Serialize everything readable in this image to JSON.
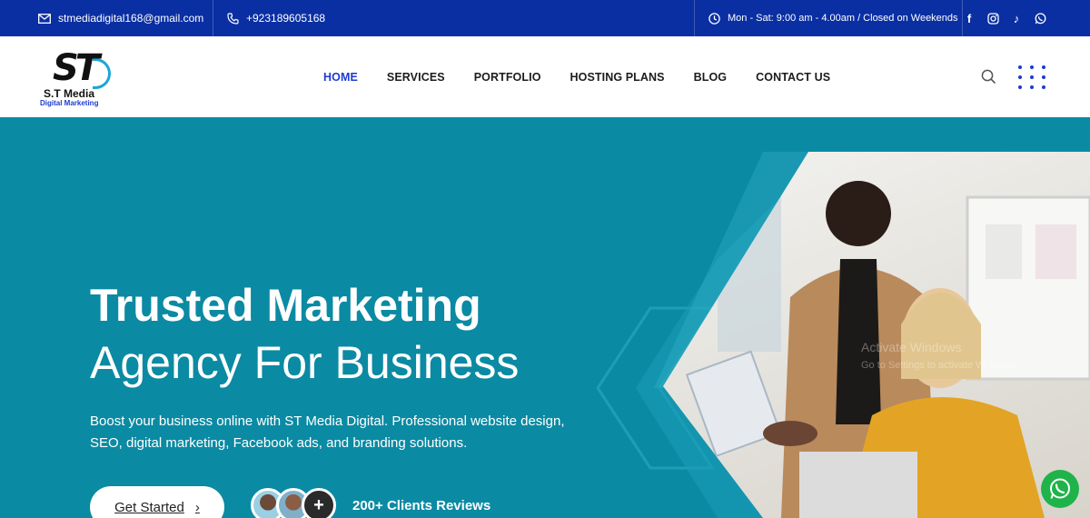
{
  "topbar": {
    "email": "stmediadigital168@gmail.com",
    "phone": "+923189605168",
    "hours": "Mon - Sat: 9:00 am - 4.00am / Closed on Weekends",
    "social": [
      {
        "icon": "facebook-icon",
        "glyph": "f"
      },
      {
        "icon": "instagram-icon",
        "glyph": ""
      },
      {
        "icon": "tiktok-icon",
        "glyph": "♪"
      },
      {
        "icon": "whatsapp-icon",
        "glyph": ""
      }
    ]
  },
  "logo": {
    "mark": "ST",
    "name": "S.T Media",
    "tagline": "Digital Marketing"
  },
  "nav": {
    "items": [
      {
        "label": "HOME",
        "active": true
      },
      {
        "label": "SERVICES",
        "active": false
      },
      {
        "label": "PORTFOLIO",
        "active": false
      },
      {
        "label": "HOSTING PLANS",
        "active": false
      },
      {
        "label": "BLOG",
        "active": false
      },
      {
        "label": "CONTACT US",
        "active": false
      }
    ]
  },
  "hero": {
    "title_line1": "Trusted Marketing",
    "title_line2": "Agency For Business",
    "description": "Boost your business online with ST Media Digital. Professional website design, SEO, digital marketing, Facebook ads, and branding solutions.",
    "cta_label": "Get Started",
    "cta_arrow": "›",
    "more_glyph": "+",
    "reviews_label": "200+ Clients Reviews"
  },
  "watermark": {
    "line1": "Activate Windows",
    "line2": "Go to Settings to activate Windows."
  },
  "colors": {
    "topbar": "#0a2fa3",
    "accent": "#1d3bd1",
    "hero": "#0b8aa3",
    "whatsapp": "#1fb34a"
  }
}
